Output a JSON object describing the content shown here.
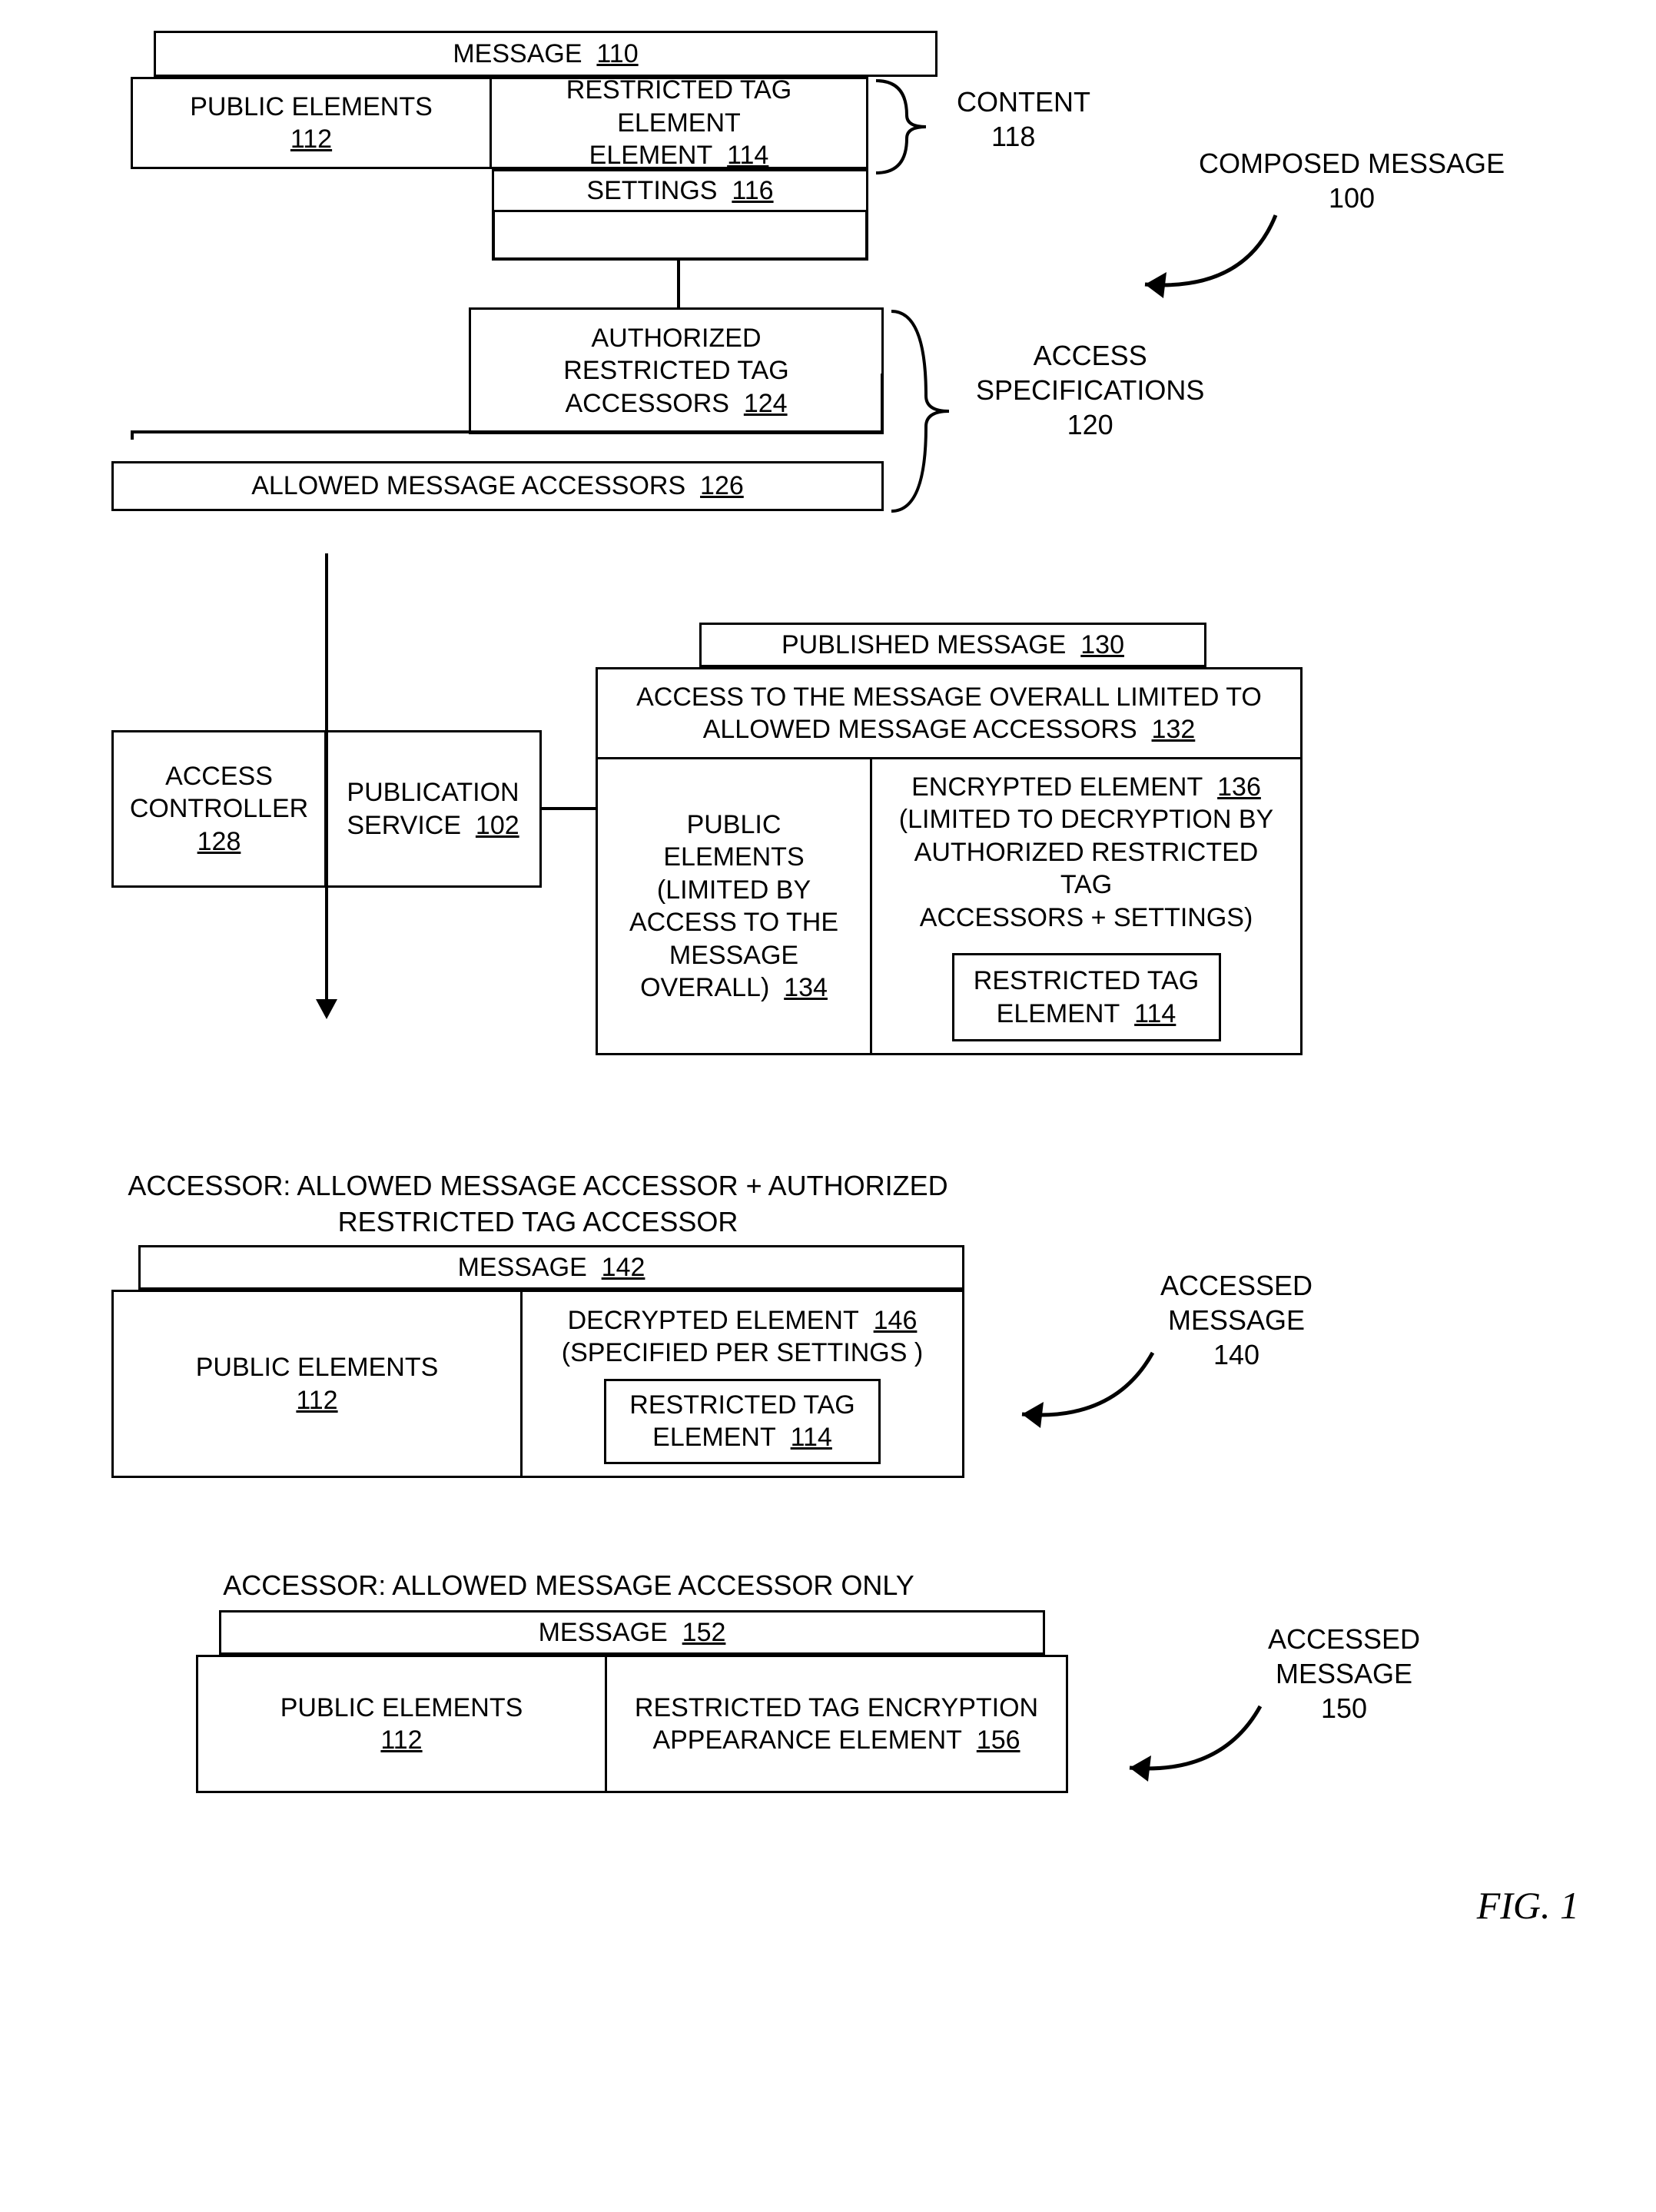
{
  "composed": {
    "message": {
      "label": "MESSAGE",
      "ref": "110"
    },
    "public_elements": {
      "label": "PUBLIC ELEMENTS",
      "ref": "112"
    },
    "restricted_tag_element": {
      "label": "RESTRICTED TAG ELEMENT",
      "ref": "114"
    },
    "settings": {
      "label": "SETTINGS",
      "ref": "116"
    },
    "content": {
      "label": "CONTENT",
      "ref": "118"
    },
    "authorized_accessors": {
      "label": "AUTHORIZED RESTRICTED TAG ACCESSORS",
      "ref": "124"
    },
    "allowed_accessors": {
      "label": "ALLOWED MESSAGE ACCESSORS",
      "ref": "126"
    },
    "access_spec": {
      "label": "ACCESS SPECIFICATIONS",
      "ref": "120"
    },
    "title": {
      "label": "COMPOSED MESSAGE",
      "ref": "100"
    }
  },
  "publication": {
    "access_controller": {
      "label": "ACCESS CONTROLLER",
      "ref": "128"
    },
    "publication_service": {
      "label": "PUBLICATION SERVICE",
      "ref": "102"
    },
    "published_message": {
      "label": "PUBLISHED MESSAGE",
      "ref": "130"
    },
    "overall_access": {
      "label": "ACCESS TO THE MESSAGE OVERALL LIMITED TO ALLOWED MESSAGE ACCESSORS",
      "ref": "132"
    },
    "public_elements": {
      "label": "PUBLIC ELEMENTS (LIMITED BY ACCESS TO THE MESSAGE OVERALL)",
      "ref": "134"
    },
    "encrypted_element": {
      "label": "ENCRYPTED ELEMENT",
      "ref": "136"
    },
    "encrypted_note": "(LIMITED TO DECRYPTION BY AUTHORIZED RESTRICTED TAG ACCESSORS + SETTINGS)",
    "restricted_tag_element": {
      "label": "RESTRICTED TAG ELEMENT",
      "ref": "114"
    }
  },
  "accessed1": {
    "header": "ACCESSOR: ALLOWED MESSAGE ACCESSOR + AUTHORIZED RESTRICTED TAG ACCESSOR",
    "message": {
      "label": "MESSAGE",
      "ref": "142"
    },
    "public_elements": {
      "label": "PUBLIC ELEMENTS",
      "ref": "112"
    },
    "decrypted_element": {
      "label": "DECRYPTED ELEMENT",
      "ref": "146"
    },
    "decrypted_note": "(SPECIFIED PER SETTINGS )",
    "restricted_tag_element": {
      "label": "RESTRICTED TAG ELEMENT",
      "ref": "114"
    },
    "title": {
      "label": "ACCESSED MESSAGE",
      "ref": "140"
    }
  },
  "accessed2": {
    "header": "ACCESSOR: ALLOWED MESSAGE ACCESSOR ONLY",
    "message": {
      "label": "MESSAGE",
      "ref": "152"
    },
    "public_elements": {
      "label": "PUBLIC ELEMENTS",
      "ref": "112"
    },
    "encryption_appearance": {
      "label": "RESTRICTED TAG ENCRYPTION APPEARANCE ELEMENT",
      "ref": "156"
    },
    "title": {
      "label": "ACCESSED MESSAGE",
      "ref": "150"
    }
  },
  "figure": "FIG. 1"
}
